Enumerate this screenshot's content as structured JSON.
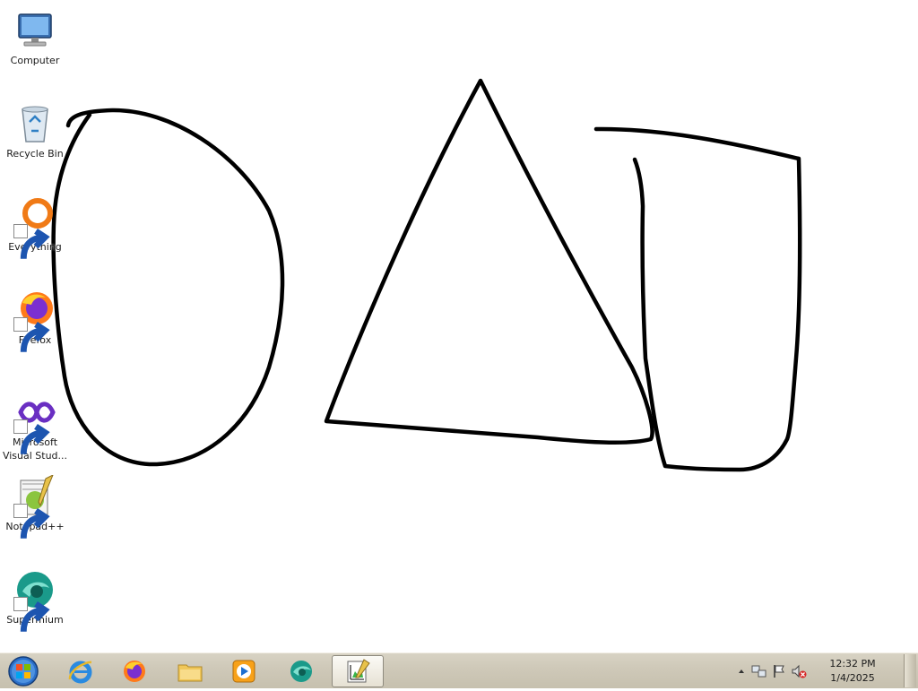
{
  "desktop": {
    "icons": [
      {
        "label": "Computer",
        "icon": "computer-icon"
      },
      {
        "label": "Recycle Bin",
        "icon": "recycle-bin-icon"
      },
      {
        "label": "Everything",
        "icon": "everything-search-icon"
      },
      {
        "label": "Firefox",
        "icon": "firefox-icon"
      },
      {
        "label": "Microsoft Visual Stud...",
        "label_line1": "Microsoft",
        "label_line2": "Visual Stud...",
        "icon": "visual-studio-icon"
      },
      {
        "label": "Notepad++",
        "icon": "notepad-plus-plus-icon"
      },
      {
        "label": "Supermium",
        "icon": "supermium-icon"
      }
    ]
  },
  "canvas": {
    "shapes": [
      "oval",
      "triangle",
      "cup"
    ],
    "stroke_color": "#000000"
  },
  "taskbar": {
    "start_icon": "windows-orb-icon",
    "pinned": [
      {
        "name": "Internet Explorer",
        "icon": "internet-explorer-icon"
      },
      {
        "name": "Firefox",
        "icon": "firefox-icon"
      },
      {
        "name": "File Explorer",
        "icon": "folder-icon"
      },
      {
        "name": "Windows Media Player",
        "icon": "media-player-icon"
      },
      {
        "name": "Supermium",
        "icon": "supermium-icon"
      },
      {
        "name": "Paint",
        "icon": "paint-app-icon",
        "active": true
      }
    ],
    "tray": {
      "icons": [
        "show-hidden-icons-arrow",
        "network-icon",
        "action-center-flag-icon",
        "volume-muted-icon"
      ],
      "time": "12:32 PM",
      "date": "1/4/2025"
    }
  },
  "colors": {
    "taskbar_bg": "#cfc9b9",
    "desktop_bg": "#ffffff",
    "accent": "#1e73d8"
  }
}
